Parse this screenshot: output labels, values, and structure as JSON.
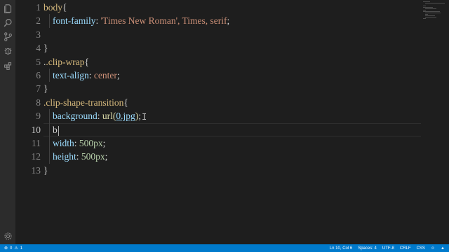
{
  "activity_bar": {
    "icons": [
      "files-icon",
      "search-icon",
      "source-control-icon",
      "debug-icon",
      "extensions-icon",
      "settings-gear-icon"
    ]
  },
  "editor": {
    "line_numbers": [
      "1",
      "2",
      "3",
      "4",
      "5",
      "6",
      "7",
      "8",
      "9",
      "10",
      "11",
      "12",
      "13"
    ],
    "active_line": "10",
    "lines": {
      "l1": {
        "selector": "body",
        "brace": "{"
      },
      "l2": {
        "property": "font-family",
        "colon": ": ",
        "value": "'Times New Roman'",
        "rest": ", Times, serif",
        "semi": ";"
      },
      "l4": {
        "brace": "}"
      },
      "l5": {
        "dot": ".",
        "selector": ".clip-wrap",
        "brace": "{"
      },
      "l6": {
        "property": "text-align",
        "colon": ": ",
        "value": "center",
        "semi": ";"
      },
      "l7": {
        "brace": "}"
      },
      "l8": {
        "selector": ".clip-shape-transition",
        "brace": "{"
      },
      "l9": {
        "property": "background",
        "colon": ": ",
        "fn": "url(",
        "link": "0.jpg",
        "close": ")",
        "semi": ";"
      },
      "l10": {
        "typed": "b"
      },
      "l11": {
        "property": "width",
        "colon": ": ",
        "value": "500px",
        "semi": ";"
      },
      "l12": {
        "property": "height",
        "colon": ": ",
        "value": "500px",
        "semi": ";"
      },
      "l13": {
        "brace": "}"
      }
    }
  },
  "statusbar": {
    "errors": "0",
    "warnings": "1",
    "position": "Ln 10, Col 6",
    "spaces": "Spaces: 4",
    "encoding": "UTF-8",
    "eol": "CRLF",
    "language": "CSS"
  },
  "colors": {
    "statusbar_bg": "#007acc",
    "editor_bg": "#1e1e1e",
    "selector": "#d7ba7d",
    "property": "#9cdcfe",
    "string": "#ce9178",
    "function": "#dcdcaa"
  }
}
